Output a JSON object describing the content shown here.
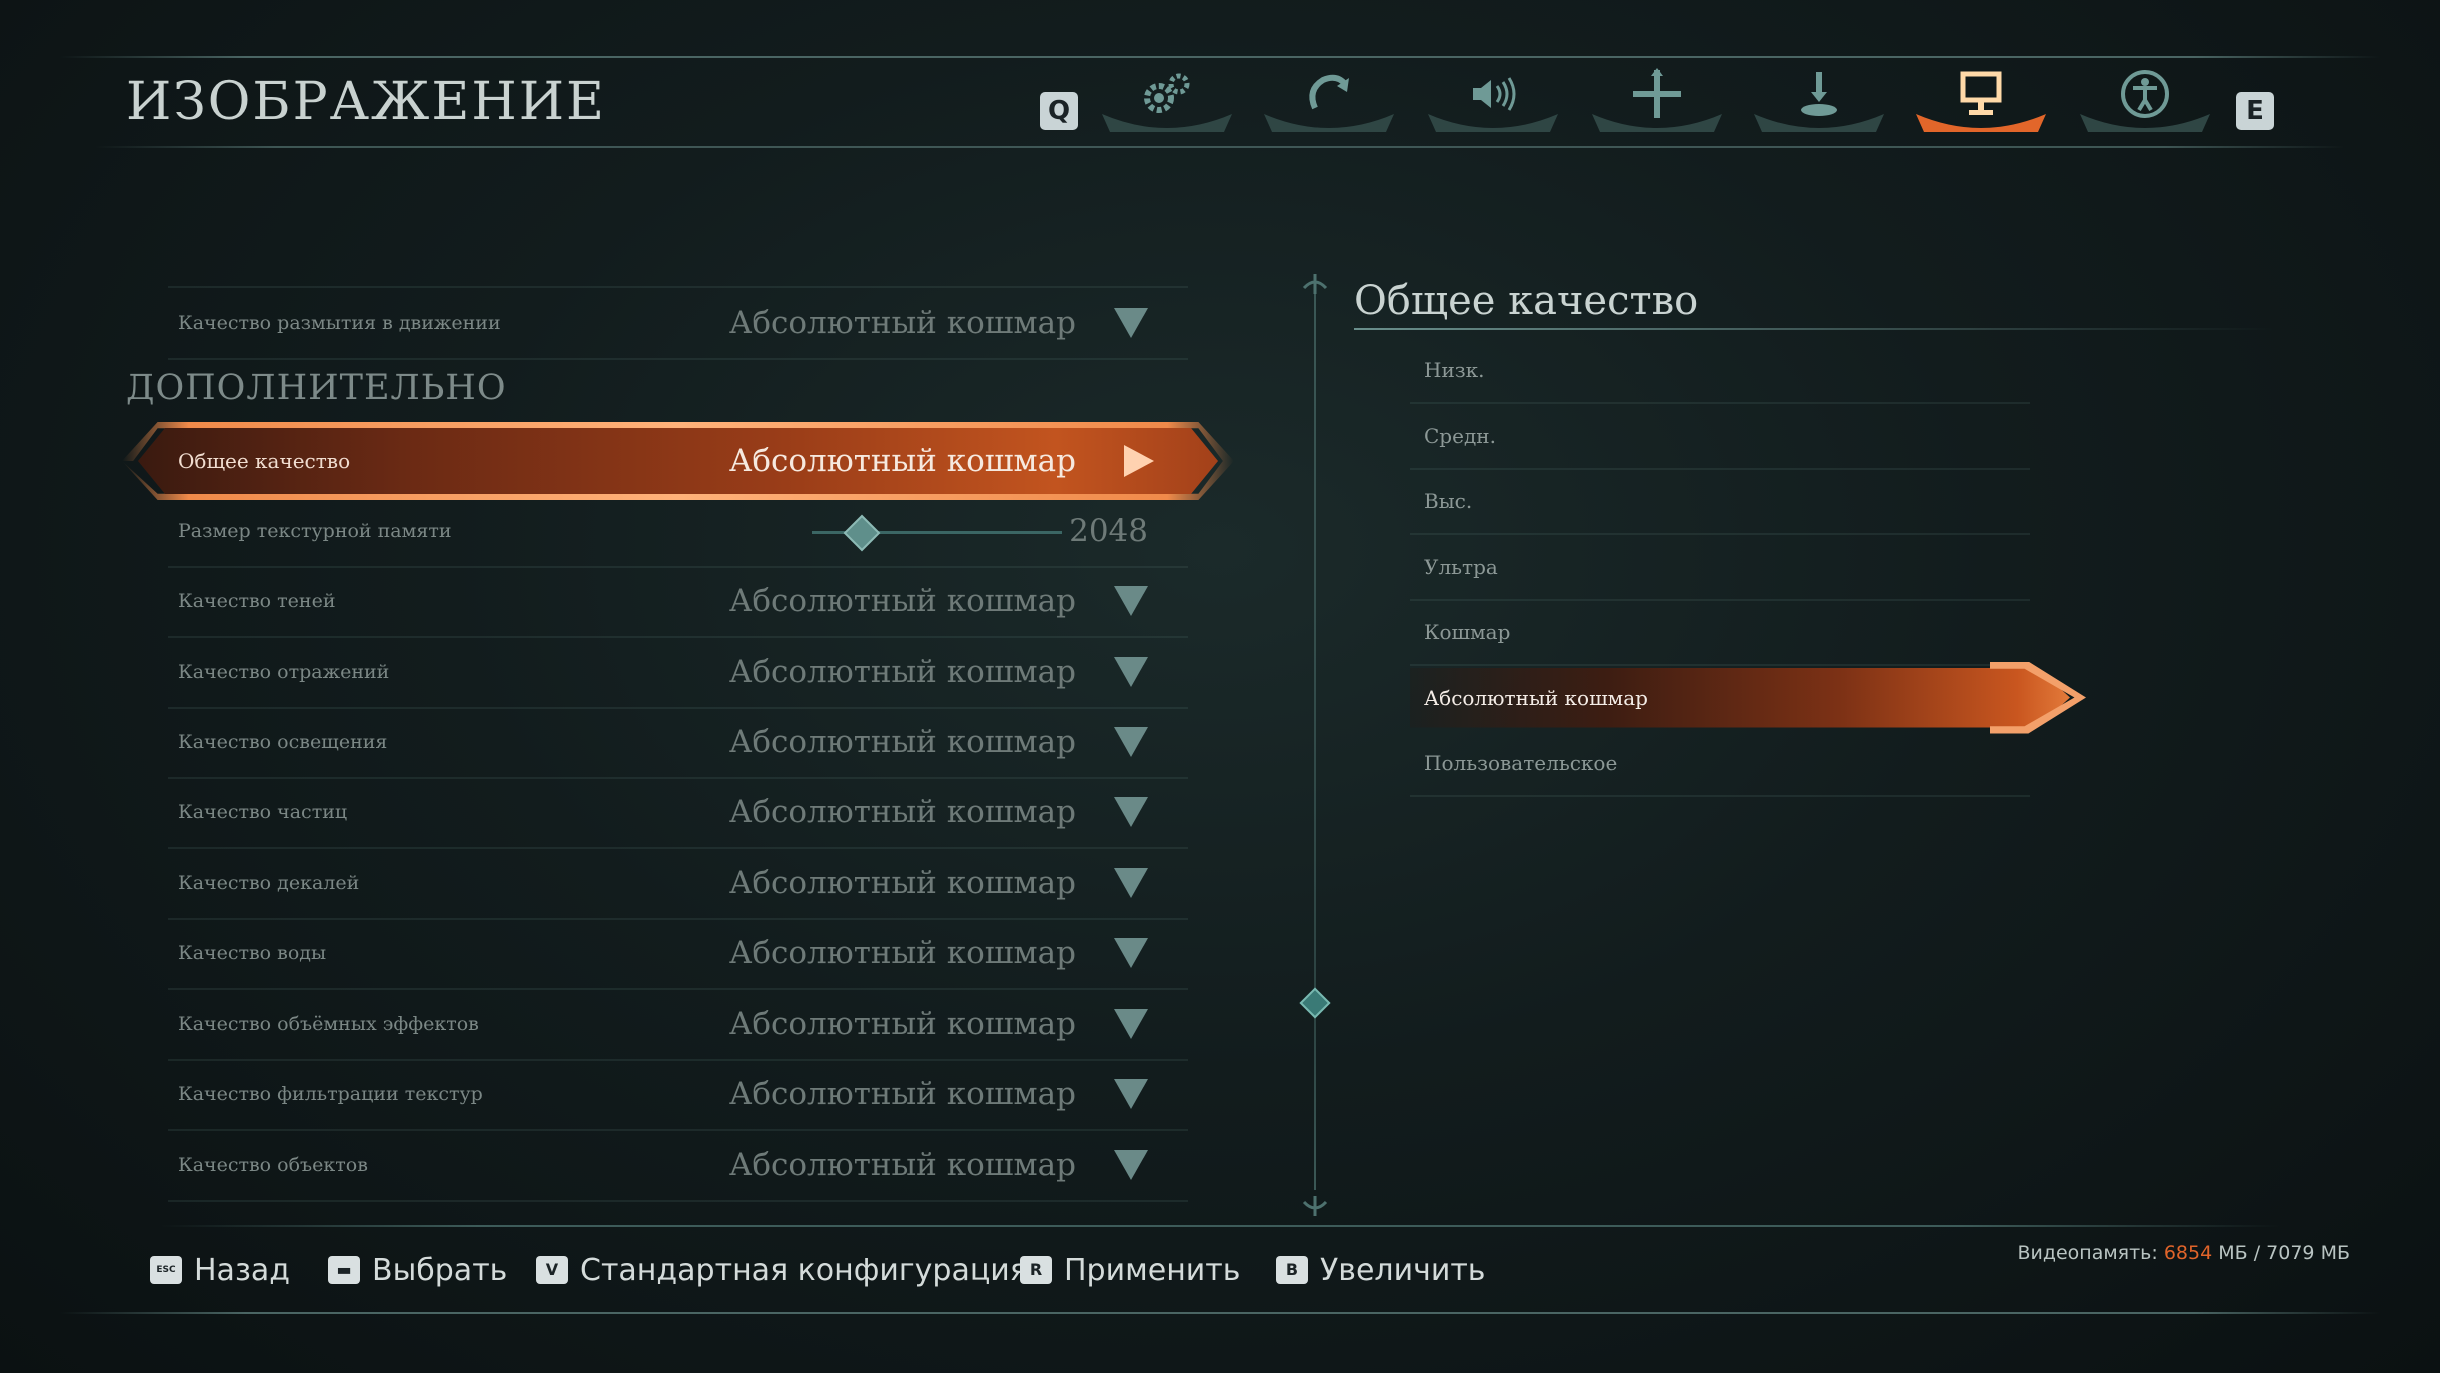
{
  "header": {
    "title": "ИЗОБРАЖЕНИЕ",
    "prev_key": "Q",
    "next_key": "E",
    "tabs": [
      {
        "icon": "gears-icon",
        "active": false
      },
      {
        "icon": "controller-icon",
        "active": false
      },
      {
        "icon": "speaker-icon",
        "active": false
      },
      {
        "icon": "crosshair-move-icon",
        "active": false
      },
      {
        "icon": "joystick-icon",
        "active": false
      },
      {
        "icon": "monitor-icon",
        "active": true
      },
      {
        "icon": "accessibility-icon",
        "active": false
      }
    ]
  },
  "settings": {
    "top_row": {
      "label": "Качество размытия в движении",
      "value": "Абсолютный кошмар"
    },
    "section_title": "ДОПОЛНИТЕЛЬНО",
    "overall": {
      "label": "Общее качество",
      "value": "Абсолютный кошмар"
    },
    "texture_memory": {
      "label": "Размер текстурной памяти",
      "value": "2048",
      "slider_fraction": 0.2
    },
    "rows": [
      {
        "label": "Качество теней",
        "value": "Абсолютный кошмар"
      },
      {
        "label": "Качество отражений",
        "value": "Абсолютный кошмар"
      },
      {
        "label": "Качество освещения",
        "value": "Абсолютный кошмар"
      },
      {
        "label": "Качество частиц",
        "value": "Абсолютный кошмар"
      },
      {
        "label": "Качество декалей",
        "value": "Абсолютный кошмар"
      },
      {
        "label": "Качество воды",
        "value": "Абсолютный кошмар"
      },
      {
        "label": "Качество объёмных эффектов",
        "value": "Абсолютный кошмар"
      },
      {
        "label": "Качество фильтрации текстур",
        "value": "Абсолютный кошмар"
      },
      {
        "label": "Качество объектов",
        "value": "Абсолютный кошмар"
      }
    ]
  },
  "options_panel": {
    "title": "Общее качество",
    "options": [
      "Низк.",
      "Средн.",
      "Выс.",
      "Ультра",
      "Кошмар",
      "Абсолютный кошмар",
      "Пользовательское"
    ],
    "selected": "Абсолютный кошмар"
  },
  "footer": {
    "hints": [
      {
        "key": "ESC",
        "label": "Назад"
      },
      {
        "key": "▬",
        "label": "Выбрать"
      },
      {
        "key": "V",
        "label": "Стандартная конфигурация"
      },
      {
        "key": "R",
        "label": "Применить"
      },
      {
        "key": "B",
        "label": "Увеличить"
      }
    ],
    "vram": {
      "prefix": "Видеопамять:",
      "used": "6854",
      "unit1": "МБ /",
      "total": "7079 МБ"
    }
  },
  "colors": {
    "accent": "#e0642a",
    "teal": "#5f8f8b"
  }
}
